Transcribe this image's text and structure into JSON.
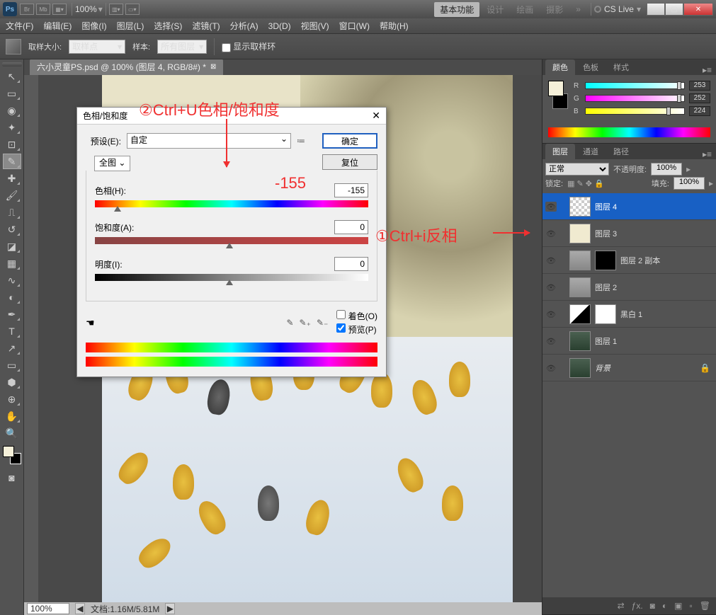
{
  "titlebar": {
    "ps": "Ps",
    "br": "Br",
    "mb": "Mb",
    "zoom": "100%",
    "workspace_active": "基本功能",
    "workspace_items": [
      "设计",
      "绘画",
      "摄影"
    ],
    "cslive": "CS Live"
  },
  "menu": [
    "文件(F)",
    "编辑(E)",
    "图像(I)",
    "图层(L)",
    "选择(S)",
    "滤镜(T)",
    "分析(A)",
    "3D(D)",
    "视图(V)",
    "窗口(W)",
    "帮助(H)"
  ],
  "optbar": {
    "sample_size_lbl": "取样大小:",
    "sample_size_val": "取样点",
    "sample_lbl": "样本:",
    "sample_val": "所有图层",
    "show_ring": "显示取样环"
  },
  "doctab": "六小灵童PS.psd @ 100% (图层 4, RGB/8#) *",
  "status": {
    "zoom": "100%",
    "doc": "文档:1.16M/5.81M"
  },
  "color_panel": {
    "tabs": [
      "颜色",
      "色板",
      "样式"
    ],
    "r": "253",
    "g": "252",
    "b": "224"
  },
  "layer_panel": {
    "tabs": [
      "图层",
      "通道",
      "路径"
    ],
    "blend": "正常",
    "opacity_lbl": "不透明度:",
    "opacity": "100%",
    "lock_lbl": "锁定:",
    "fill_lbl": "填充:",
    "fill": "100%",
    "layers": [
      {
        "name": "图层 4",
        "sel": true,
        "thumb": "checker"
      },
      {
        "name": "图层 3",
        "thumb": "cream"
      },
      {
        "name": "图层 2 副本",
        "thumb": "img1",
        "mask": "blk"
      },
      {
        "name": "图层 2",
        "thumb": "img1"
      },
      {
        "name": "黑白 1",
        "thumb": "bw",
        "mask": "wht"
      },
      {
        "name": "图层 1",
        "thumb": "img2"
      },
      {
        "name": "背景",
        "thumb": "img2",
        "locked": true,
        "italic": true
      }
    ]
  },
  "dialog": {
    "title": "色相/饱和度",
    "preset_lbl": "预设(E):",
    "preset_val": "自定",
    "ok": "确定",
    "reset": "复位",
    "range": "全图",
    "hue_lbl": "色相(H):",
    "hue_val": "-155",
    "sat_lbl": "饱和度(A):",
    "sat_val": "0",
    "light_lbl": "明度(I):",
    "light_val": "0",
    "colorize": "着色(O)",
    "preview": "预览(P)"
  },
  "anno": {
    "a1": "①Ctrl+i反相",
    "a2": "②Ctrl+U色相/饱和度",
    "a3": "-155"
  }
}
